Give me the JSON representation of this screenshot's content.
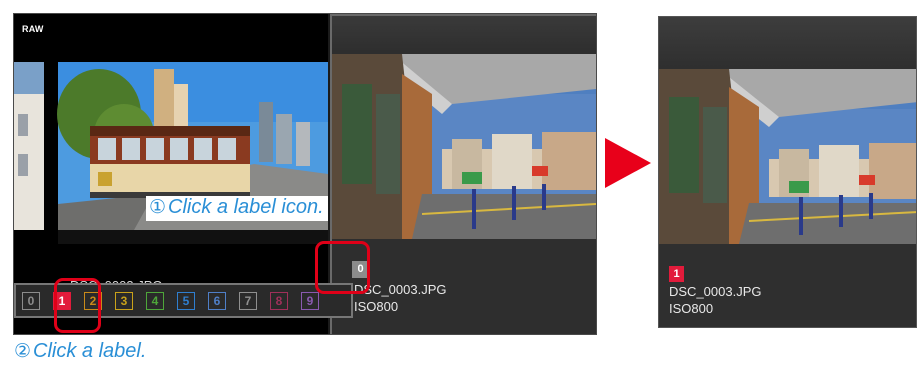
{
  "browser": {
    "raw_badge": "RAW",
    "thumb1_filename_partial": "DSC_0003.JPG",
    "thumb2": {
      "label_badge": "0",
      "filename": "DSC_0003.JPG",
      "iso": "ISO800"
    }
  },
  "label_strip": {
    "labels": [
      {
        "text": "0",
        "color": "#8c8c8c"
      },
      {
        "text": "1",
        "color": "#e21b3b"
      },
      {
        "text": "2",
        "color": "#c98a1a"
      },
      {
        "text": "3",
        "color": "#c9a21a"
      },
      {
        "text": "4",
        "color": "#4ea63a"
      },
      {
        "text": "5",
        "color": "#2f7fd0"
      },
      {
        "text": "6",
        "color": "#4f7fc8"
      },
      {
        "text": "7",
        "color": "#8f8f8f"
      },
      {
        "text": "8",
        "color": "#a0305a"
      },
      {
        "text": "9",
        "color": "#8a5ab0"
      }
    ],
    "selected": "1"
  },
  "callouts": {
    "step1_num": "①",
    "step1_text": "Click a label icon.",
    "step2_num": "②",
    "step2_text": "Click a label."
  },
  "result": {
    "label_badge": "1",
    "filename": "DSC_0003.JPG",
    "iso": "ISO800"
  },
  "colors": {
    "highlight": "#e00018",
    "callout_text": "#2a8fd6",
    "arrow": "#e8001a"
  }
}
